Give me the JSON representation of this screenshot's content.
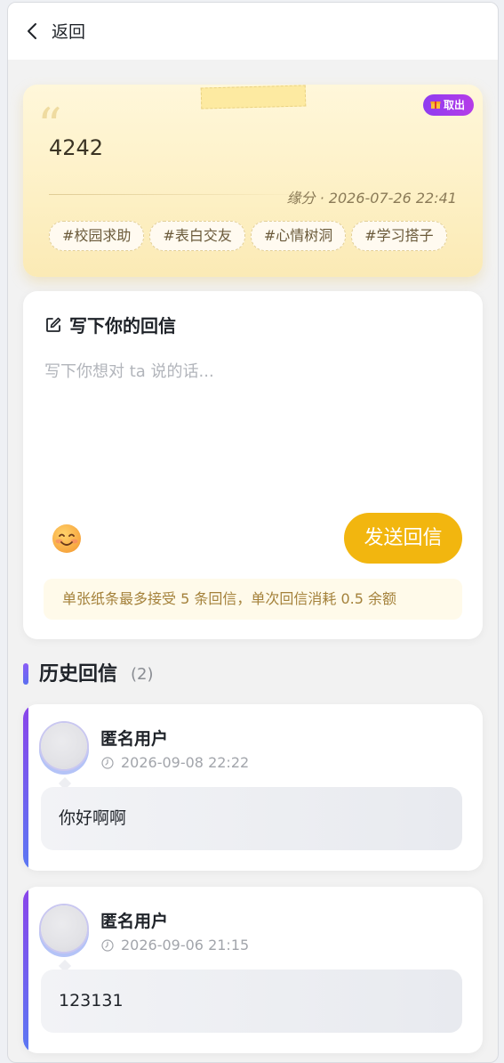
{
  "header": {
    "back_label": "返回"
  },
  "note": {
    "badge_label": "取出",
    "content": "4242",
    "meta": "缘分 · 2026-07-26 22:41",
    "tags": [
      "#校园求助",
      "#表白交友",
      "#心情树洞",
      "#学习搭子"
    ]
  },
  "reply": {
    "title": "写下你的回信",
    "placeholder": "写下你想对 ta 说的话...",
    "emoji_icon": "smiling-face-icon",
    "send_label": "发送回信",
    "notice": "单张纸条最多接受 5 条回信，单次回信消耗 0.5 余额"
  },
  "history": {
    "title": "历史回信",
    "count": "(2)",
    "items": [
      {
        "user": "匿名用户",
        "time": "2026-09-08 22:22",
        "message": "你好啊啊"
      },
      {
        "user": "匿名用户",
        "time": "2026-09-06 21:15",
        "message": "123131"
      }
    ]
  },
  "colors": {
    "accent_yellow": "#f2b60f",
    "badge_purple": "#8e3cf0",
    "history_accent": "#5b78f3"
  }
}
